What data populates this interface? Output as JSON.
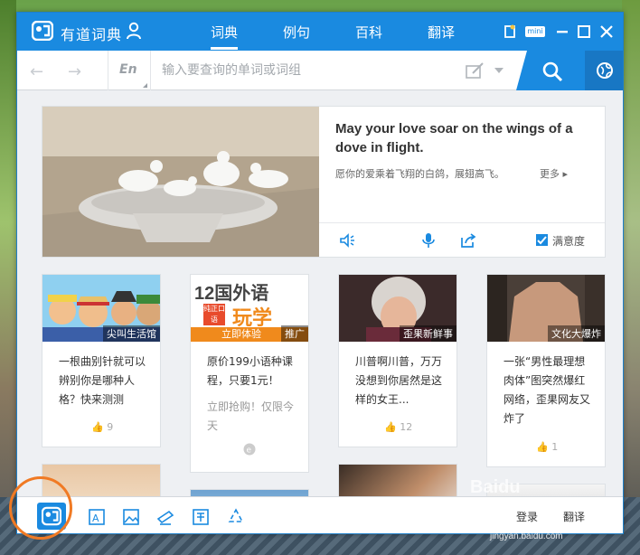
{
  "app": {
    "title": "有道词典",
    "nav_tabs": [
      "词典",
      "例句",
      "百科",
      "翻译"
    ],
    "window_badge": "mini"
  },
  "search": {
    "lang": "En",
    "placeholder": "输入要查询的单词或词组"
  },
  "daily": {
    "sentence": "May your love soar on the wings of a dove in flight.",
    "translation": "愿你的爱乘着飞翔的白鸽，展翅高飞。",
    "more": "更多",
    "satisfaction": "满意度"
  },
  "cards": [
    {
      "tag": "尖叫生活馆",
      "title": "一根曲别针就可以辨别你是哪种人格？快来测测",
      "likes": "9"
    },
    {
      "tag": "推广",
      "title": "原价199小语种课程，只要1元！",
      "sub": "立即抢购！仅限今天",
      "banner_line1": "12国外语",
      "banner_line2": "纯正口语",
      "banner_line3": "玩学",
      "banner_cta": "立即体验"
    },
    {
      "tag": "歪果新鲜事",
      "title": "川普啊川普，万万没想到你居然是这样的女王...",
      "likes": "12"
    },
    {
      "tag": "文化大爆炸",
      "title": "一张“男性最理想肉体”图突然爆红网络，歪果网友又炸了",
      "likes": "1"
    }
  ],
  "bottom": {
    "right_label_1": "登录",
    "right_label_2": "翻译"
  },
  "watermark": {
    "brand": "Baidu",
    "url": "jingyan.baidu.com"
  },
  "colors": {
    "brand_blue": "#1a8ae0",
    "highlight_orange": "#f07a24"
  }
}
